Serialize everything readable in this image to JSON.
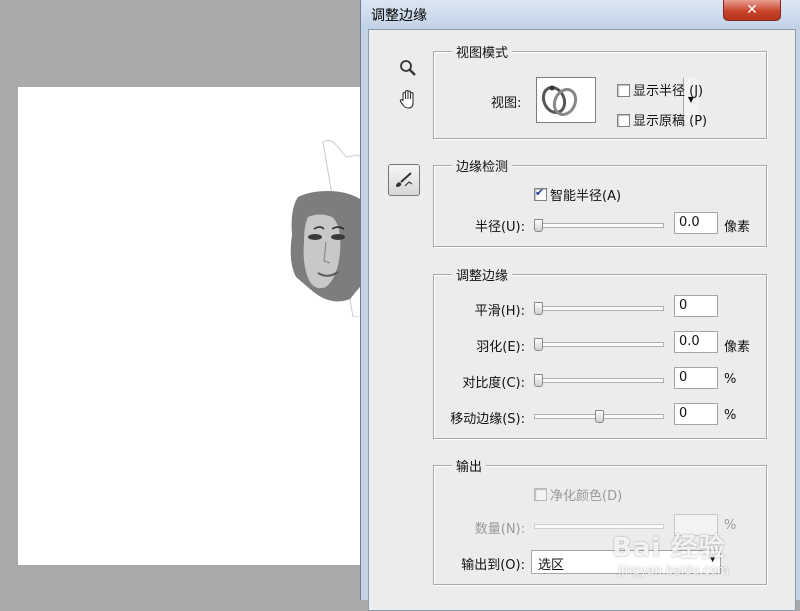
{
  "dialog": {
    "title": "调整边缘",
    "close_symbol": "✕"
  },
  "tools": [
    "zoom-icon",
    "hand-icon",
    "refine-brush-icon"
  ],
  "view_mode": {
    "group_title": "视图模式",
    "view_label": "视图:",
    "show_radius_label": "显示半径 (J)",
    "show_radius_checked": false,
    "show_original_label": "显示原稿 (P)",
    "show_original_checked": false
  },
  "edge_detection": {
    "group_title": "边缘检测",
    "smart_radius_label": "智能半径(A)",
    "smart_radius_checked": true,
    "radius_label": "半径(U):",
    "radius_value": "0.0",
    "radius_unit": "像素",
    "radius_slider": 0
  },
  "adjust_edge": {
    "group_title": "调整边缘",
    "rows": [
      {
        "label": "平滑(H):",
        "value": "0",
        "unit": "",
        "slider": 0
      },
      {
        "label": "羽化(E):",
        "value": "0.0",
        "unit": "像素",
        "slider": 0
      },
      {
        "label": "对比度(C):",
        "value": "0",
        "unit": "%",
        "slider": 0
      },
      {
        "label": "移动边缘(S):",
        "value": "0",
        "unit": "%",
        "slider": 0.5
      }
    ]
  },
  "output": {
    "group_title": "输出",
    "decontaminate_label": "净化颜色(D)",
    "decontaminate_checked": false,
    "amount_label": "数量(N):",
    "amount_value": "",
    "amount_unit": "%",
    "output_to_label": "输出到(O):",
    "output_to_value": "选区"
  },
  "watermark": {
    "logo": "Bai 经验",
    "url": "jingyan.baidu.com"
  },
  "colors": {
    "canvas_bg": "#a9a9a9",
    "dialog_frame": "#c4d3e4",
    "close_button": "#c9452d",
    "panel_bg": "#ececec",
    "check_mark": "#1f3f9c"
  }
}
